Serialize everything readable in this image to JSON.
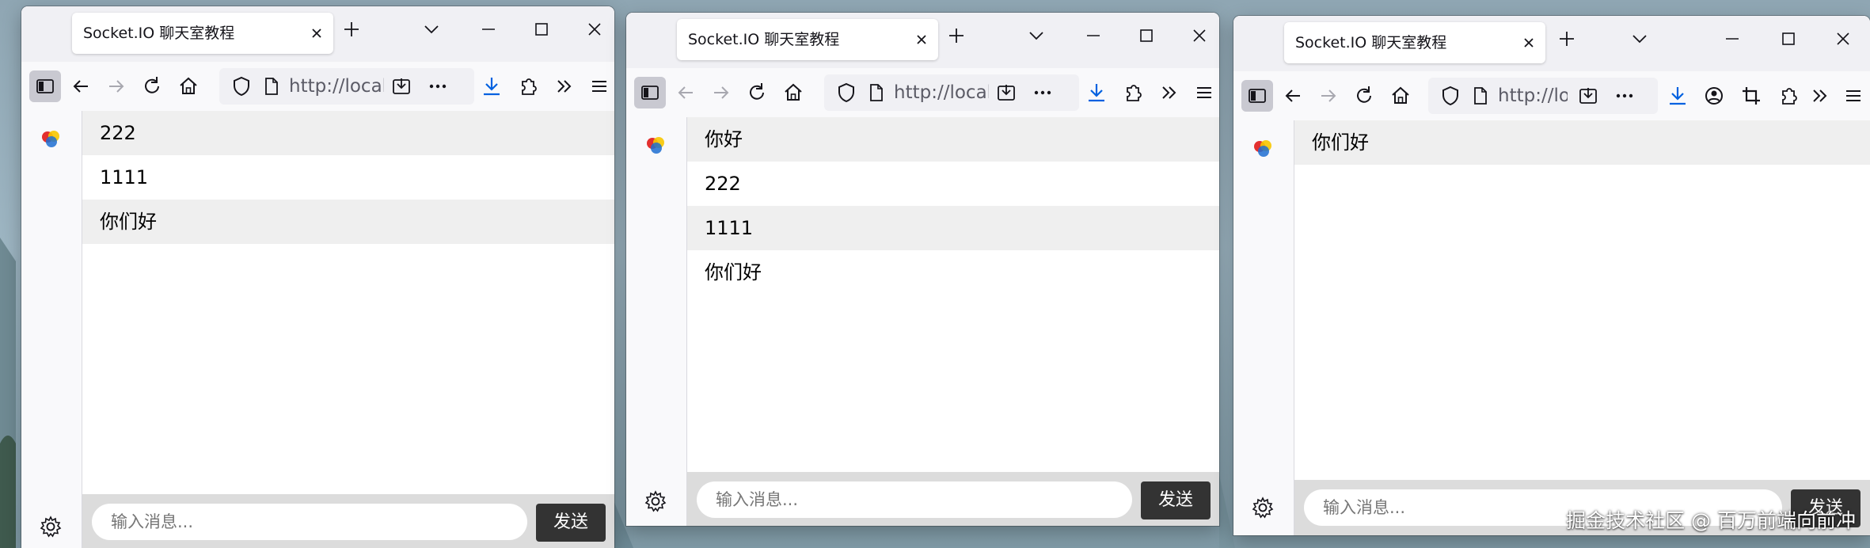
{
  "windows": [
    {
      "tab_title": "Socket.IO 聊天室教程",
      "url": "http://localh",
      "messages": [
        "222",
        "1111",
        "你们好"
      ],
      "input_placeholder": "输入消息...",
      "send_label": "发送"
    },
    {
      "tab_title": "Socket.IO 聊天室教程",
      "url": "http://localh",
      "messages": [
        "你好",
        "222",
        "1111",
        "你们好"
      ],
      "input_placeholder": "输入消息...",
      "send_label": "发送"
    },
    {
      "tab_title": "Socket.IO 聊天室教程",
      "url": "http://lo",
      "messages": [
        "你们好"
      ],
      "input_placeholder": "输入消息...",
      "send_label": "发送"
    }
  ],
  "watermark": "掘金技术社区 @ 百万前端向前冲",
  "colors": {
    "send_button": "#333333",
    "odd_message_bg": "#efefef",
    "form_bg": "#dcdcdc",
    "download_icon": "#0061e0"
  }
}
